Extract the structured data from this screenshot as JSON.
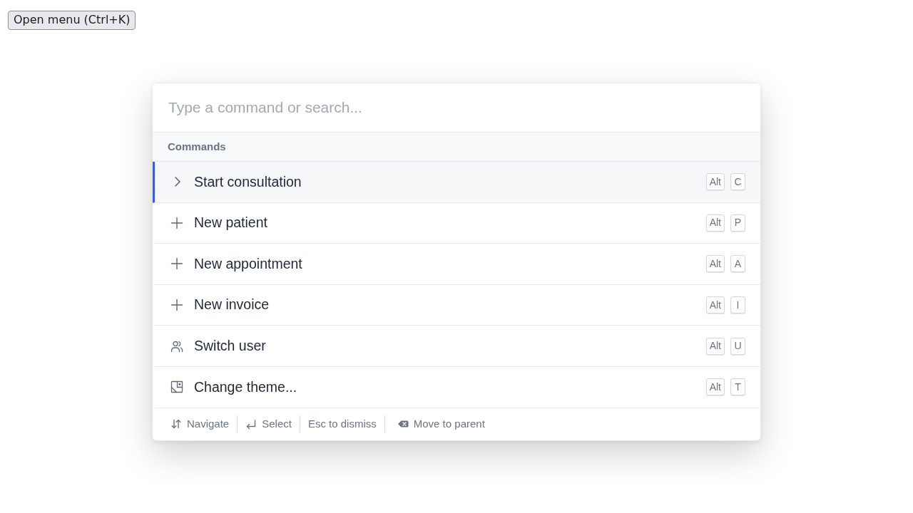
{
  "trigger_button": {
    "label": "Open menu (Ctrl+K)"
  },
  "palette": {
    "search": {
      "placeholder": "Type a command or search..."
    },
    "group": {
      "heading": "Commands"
    },
    "commands": [
      {
        "kind": "go",
        "label": "Start consultation",
        "shortcut": [
          "Alt",
          "C"
        ],
        "selected": true
      },
      {
        "kind": "add",
        "label": "New patient",
        "shortcut": [
          "Alt",
          "P"
        ],
        "selected": false
      },
      {
        "kind": "add",
        "label": "New appointment",
        "shortcut": [
          "Alt",
          "A"
        ],
        "selected": false
      },
      {
        "kind": "add",
        "label": "New invoice",
        "shortcut": [
          "Alt",
          "I"
        ],
        "selected": false
      },
      {
        "kind": "users",
        "label": "Switch user",
        "shortcut": [
          "Alt",
          "U"
        ],
        "selected": false
      },
      {
        "kind": "theme",
        "label": "Change theme...",
        "shortcut": [
          "Alt",
          "T"
        ],
        "selected": false
      }
    ],
    "hints": [
      {
        "kind": "navigate",
        "label": "Navigate"
      },
      {
        "kind": "enter",
        "label": "Select"
      },
      {
        "kind": "plain",
        "label": "Esc to dismiss"
      },
      {
        "kind": "backspace",
        "label": "Move to parent"
      }
    ]
  }
}
